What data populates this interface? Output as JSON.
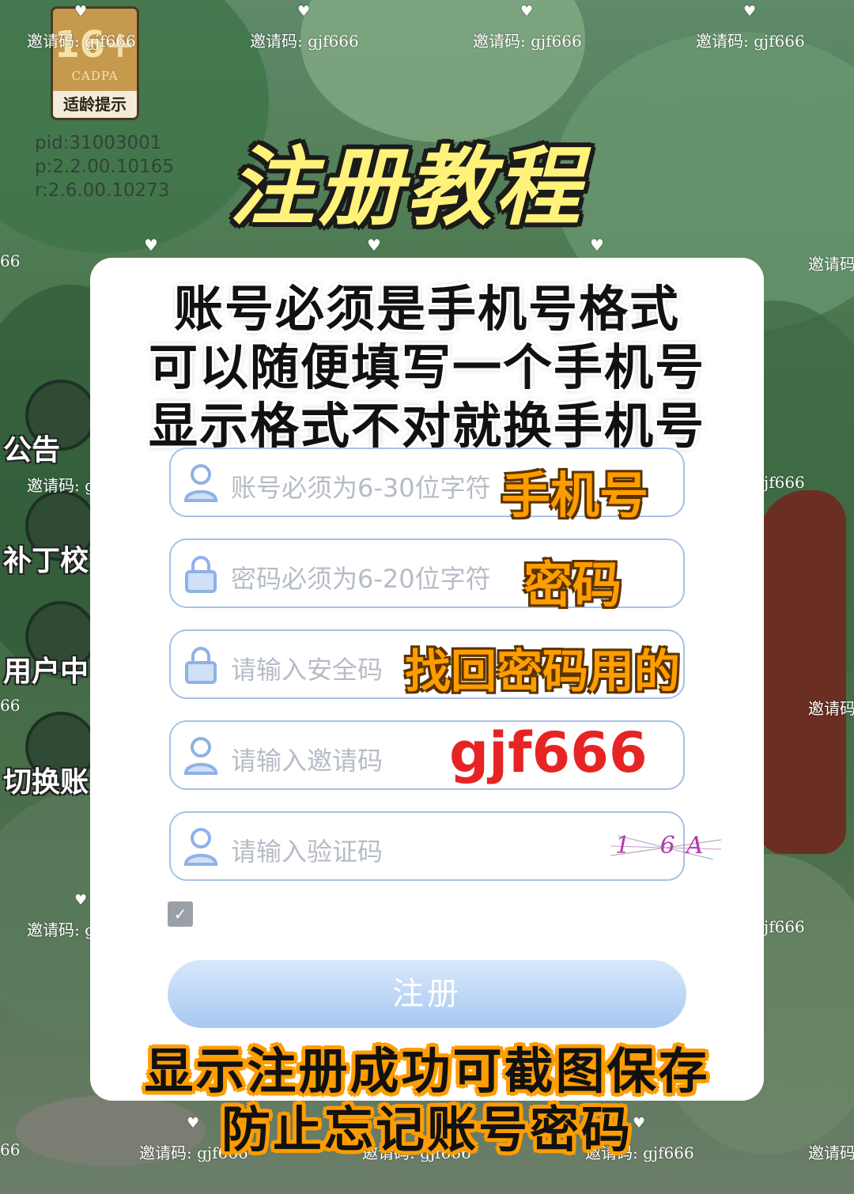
{
  "age_badge": {
    "number": "16+",
    "org": "CADPA",
    "tip": "适龄提示"
  },
  "version": {
    "pid": "pid:31003001",
    "p": "p:2.2.00.10165",
    "r": "r:2.6.00.10273"
  },
  "title": "注册教程",
  "side_menu": [
    "公告",
    "补丁校",
    "用户中",
    "切换账"
  ],
  "watermark_text": "邀请码: gjf666",
  "watermark_partial_left": "邀请码: g",
  "watermark_partial_right": "jf666",
  "watermark_edge_left": "66",
  "watermark_edge_right": "邀请码",
  "notice_lines": [
    "账号必须是手机号格式",
    "可以随便填写一个手机号",
    "显示格式不对就换手机号"
  ],
  "fields": [
    {
      "placeholder": "账号必须为6-30位字符",
      "overlay": "手机号",
      "icon": "user-icon"
    },
    {
      "placeholder": "密码必须为6-20位字符",
      "overlay": "密码",
      "icon": "lock-icon"
    },
    {
      "placeholder": "请输入安全码",
      "overlay": "找回密码用的",
      "icon": "lock-icon"
    },
    {
      "placeholder": "请输入邀请码",
      "overlay": "gjf666",
      "icon": "user-icon"
    },
    {
      "placeholder": "请输入验证码",
      "captcha": "1 6A",
      "icon": "user-icon"
    }
  ],
  "checkbox_mark": "✓",
  "register_label": "注册",
  "bottom_tip": [
    "显示注册成功可截图保存",
    "防止忘记账号密码"
  ],
  "colors": {
    "accent_orange": "#ff9d00",
    "title_yellow": "#fff27a",
    "invite_red": "#e62424",
    "button_blue": "#a8c8f2"
  }
}
